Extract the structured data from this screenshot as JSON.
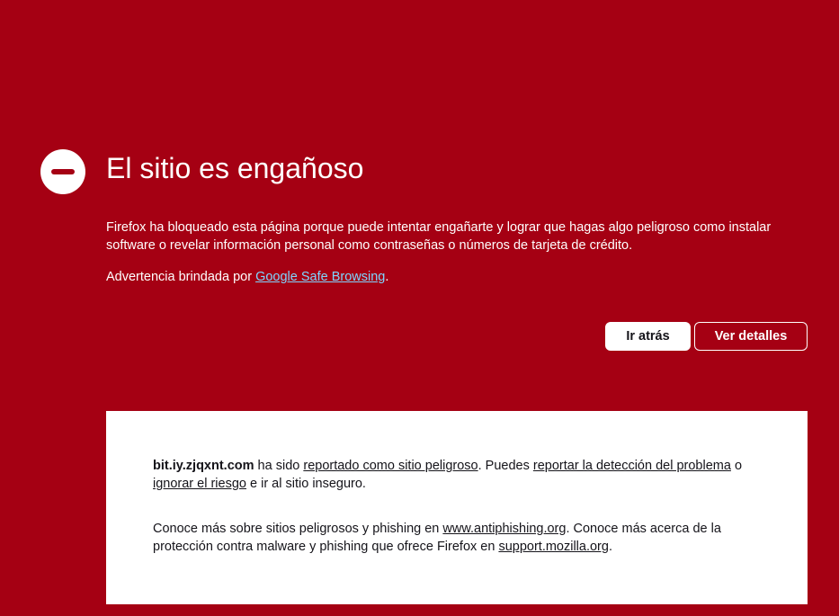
{
  "page": {
    "title": "El sitio es engañoso",
    "icon": "blocked-icon",
    "description": "Firefox ha bloqueado esta página porque puede intentar engañarte y lograr que hagas algo peligroso como instalar software o revelar información personal como contraseñas o números de tarjeta de crédito.",
    "advisory": {
      "prefix": "Advertencia brindada por ",
      "link": "Google Safe Browsing",
      "suffix": "."
    }
  },
  "buttons": {
    "back": "Ir atrás",
    "details": "Ver detalles"
  },
  "details": {
    "host": "bit.iy.zjqxnt.com",
    "t1": " ha sido ",
    "link_reported": "reportado como sitio peligroso",
    "t2": ". Puedes ",
    "link_report_error": "reportar la detección del problema",
    "t3": " o ",
    "link_ignore": "ignorar el riesgo",
    "t4": " e ir al sitio inseguro.",
    "learn_prefix": "Conoce más sobre sitios peligrosos y phishing en ",
    "link_antiphishing": "www.antiphishing.org",
    "learn_mid": ". Conoce más acerca de la protección contra malware y phishing que ofrece Firefox en ",
    "link_support": "support.mozilla.org",
    "learn_suffix": "."
  },
  "colors": {
    "background": "#a50013",
    "text": "#ffffff",
    "link": "#7fd6ff",
    "panel": "#ffffff",
    "panel_text": "#15141a"
  }
}
